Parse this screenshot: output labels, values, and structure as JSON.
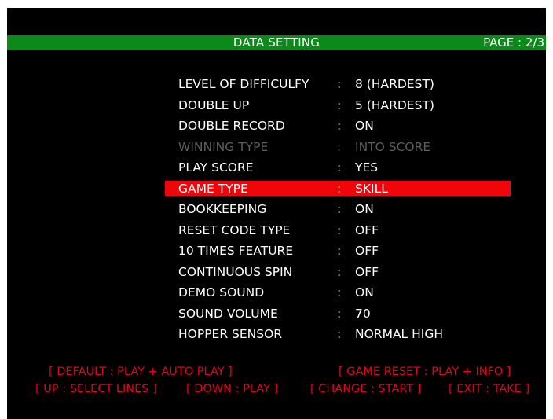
{
  "header": {
    "title": "DATA SETTING",
    "page": "PAGE : 2/3"
  },
  "colon": ":",
  "settings": [
    {
      "label": "LEVEL OF DIFFICULFY",
      "value": "8 (HARDEST)"
    },
    {
      "label": "DOUBLE UP",
      "value": "5 (HARDEST)"
    },
    {
      "label": "DOUBLE RECORD",
      "value": "ON"
    },
    {
      "label": "WINNING TYPE",
      "value": "INTO SCORE",
      "state": "disabled"
    },
    {
      "label": "PLAY SCORE",
      "value": "YES"
    },
    {
      "label": "GAME TYPE",
      "value": "SKILL",
      "state": "selected"
    },
    {
      "label": "BOOKKEEPING",
      "value": "ON"
    },
    {
      "label": "RESET CODE TYPE",
      "value": "OFF"
    },
    {
      "label": "10 TIMES FEATURE",
      "value": "OFF"
    },
    {
      "label": "CONTINUOUS SPIN",
      "value": "OFF"
    },
    {
      "label": "DEMO SOUND",
      "value": "ON"
    },
    {
      "label": "SOUND VOLUME",
      "value": "70"
    },
    {
      "label": "HOPPER SENSOR",
      "value": "NORMAL HIGH"
    }
  ],
  "help": {
    "default": "[ DEFAULT : PLAY + AUTO PLAY ]",
    "game_reset": "[ GAME RESET : PLAY + INFO ]",
    "up": "[ UP : SELECT LINES ]",
    "down": "[ DOWN : PLAY ]",
    "change": "[ CHANGE : START ]",
    "exit": "[ EXIT : TAKE ]"
  },
  "colors": {
    "header_bar": "#0b8a1a",
    "selection_bar": "#f0060a",
    "help_text": "#e8001a",
    "disabled_text": "#5f5f5f"
  }
}
